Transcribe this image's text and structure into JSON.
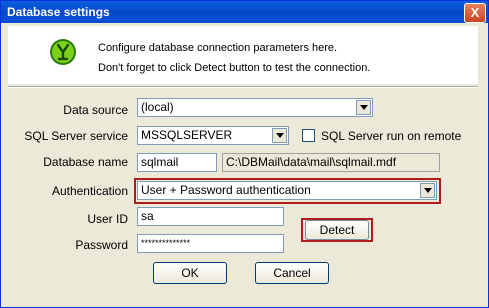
{
  "window": {
    "title": "Database settings",
    "close_glyph": "X"
  },
  "info": {
    "line1": "Configure database connection parameters here.",
    "line2": "Don't forget to click Detect button to test the connection.",
    "logo_icon": "app-logo-icon"
  },
  "form": {
    "data_source_label": "Data source",
    "data_source_value": "(local)",
    "sql_service_label": "SQL Server service",
    "sql_service_value": "MSSQLSERVER",
    "remote_checkbox_label": "SQL Server run on remote",
    "remote_checked": false,
    "db_name_label": "Database name",
    "db_name_value": "sqlmail",
    "db_path_value": "C:\\DBMail\\data\\mail\\sqlmail.mdf",
    "auth_label": "Authentication",
    "auth_value": "User + Password authentication",
    "userid_label": "User ID",
    "userid_value": "sa",
    "password_label": "Password",
    "password_value": "**************"
  },
  "buttons": {
    "detect": "Detect",
    "ok": "OK",
    "cancel": "Cancel"
  },
  "colors": {
    "highlight": "#b01c1c",
    "titlebar": "#0a5fe0"
  }
}
